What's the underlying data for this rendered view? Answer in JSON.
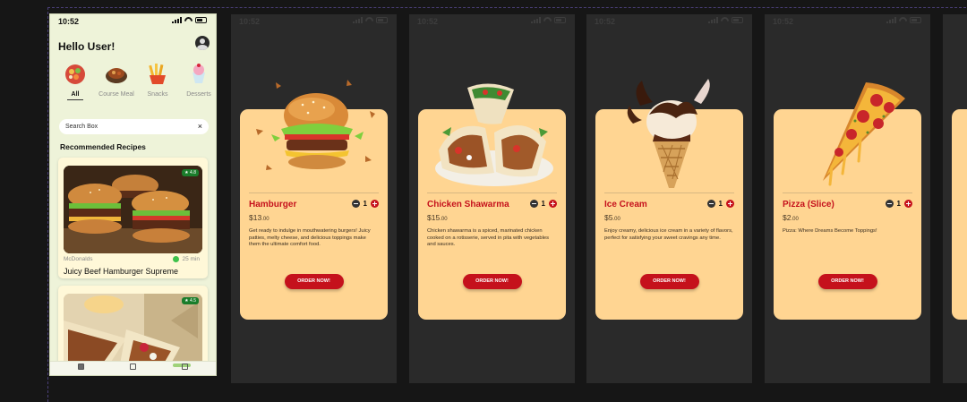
{
  "status_time": "10:52",
  "home": {
    "greeting": "Hello User!",
    "categories": [
      {
        "label": "All",
        "icon": "all-food-icon"
      },
      {
        "label": "Course Meal",
        "icon": "course-meal-icon"
      },
      {
        "label": "Snacks",
        "icon": "snacks-icon"
      },
      {
        "label": "Desserts",
        "icon": "desserts-icon"
      }
    ],
    "search_placeholder": "Search Box",
    "section_title": "Recommended Recipes",
    "recipes": [
      {
        "brand": "McDonalds",
        "time": "25 min",
        "name": "Juicy Beef Hamburger Supreme"
      }
    ]
  },
  "products": [
    {
      "name": "Hamburger",
      "price": "$13",
      "cents": ".00",
      "qty": "1",
      "desc": "Get ready to indulge in mouthwatering burgers! Juicy patties, melty cheese, and delicious toppings make them the ultimate comfort food.",
      "button": "ORDER NOW!"
    },
    {
      "name": "Chicken Shawarma",
      "price": "$15",
      "cents": ".00",
      "qty": "1",
      "desc": "Chicken shawarma is a spiced, marinated chicken cooked on a rotisserie, served in pita with vegetables and sauces.",
      "button": "ORDER NOW!"
    },
    {
      "name": "Ice Cream",
      "price": "$5",
      "cents": ".00",
      "qty": "1",
      "desc": "Enjoy creamy, delicious ice cream in a variety of flavors, perfect for satisfying your sweet cravings any time.",
      "button": "ORDER NOW!"
    },
    {
      "name": "Pizza (Slice)",
      "price": "$2",
      "cents": ".00",
      "qty": "1",
      "desc": "Pizza: Where Dreams Become Toppings!",
      "button": "ORDER NOW!"
    }
  ],
  "colors": {
    "accent": "#c5111c",
    "card": "#ffd592",
    "home_bg": "#eef3d9"
  }
}
